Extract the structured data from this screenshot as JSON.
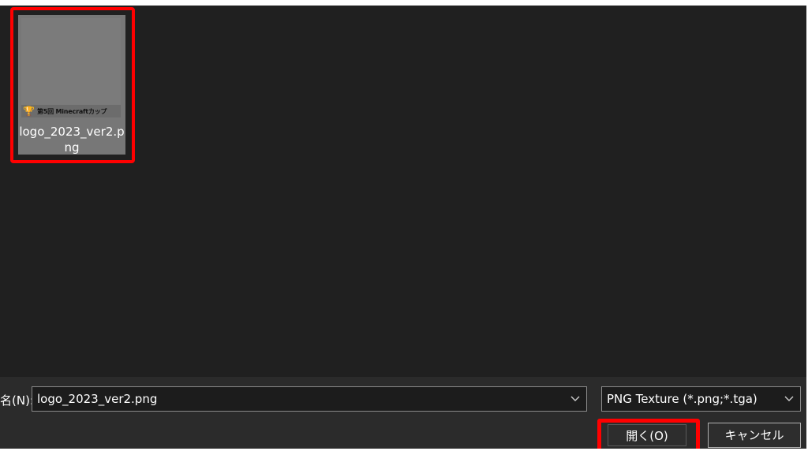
{
  "file_area": {
    "files": [
      {
        "name": "logo_2023_ver2.p\nng",
        "thumbnail_text": "第5回 Minecraftカップ",
        "icon": "trophy-icon"
      }
    ]
  },
  "bottom_bar": {
    "filename_label": "名(N):",
    "filename_value": "logo_2023_ver2.png",
    "filetype_value": "PNG Texture (*.png;*.tga)",
    "open_button": "開く(O)",
    "cancel_button": "キャンセル"
  },
  "colors": {
    "highlight": "#ff0000",
    "background": "#202020",
    "bottom_bar": "#2b2b2b"
  }
}
